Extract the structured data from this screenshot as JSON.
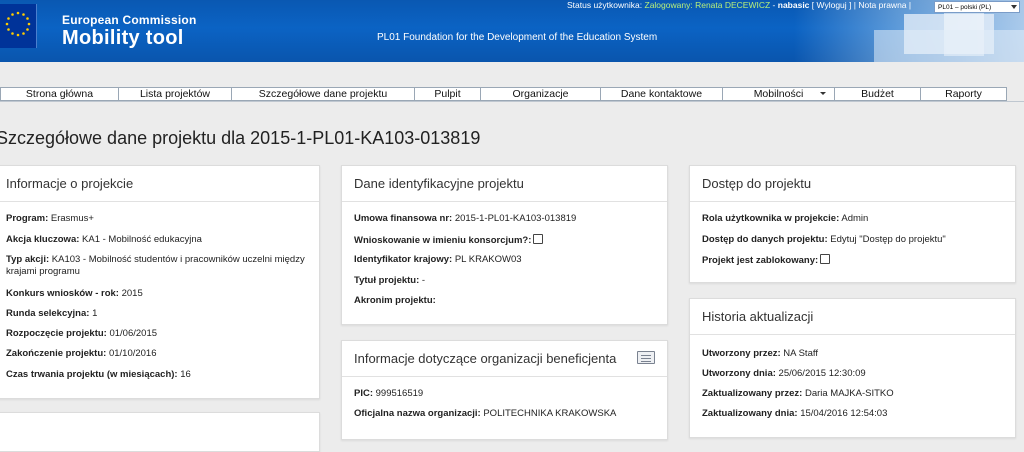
{
  "header": {
    "brand_line1": "European Commission",
    "brand_line2": "Mobility tool",
    "organisation": "PL01 Foundation for the Development of the Education System",
    "status_label": "Status użytkownika:",
    "logged_in_label": "Zalogowany:",
    "user_name": "Renata DECEWICZ",
    "user_login": "nabasic",
    "logout_label": "Wyloguj",
    "legal_label": "Nota prawna",
    "language_value": "PL01 – polski (PL)"
  },
  "nav": {
    "items": [
      {
        "label": "Strona główna"
      },
      {
        "label": "Lista projektów"
      },
      {
        "label": "Szczegółowe dane projektu"
      },
      {
        "label": "Pulpit"
      },
      {
        "label": "Organizacje"
      },
      {
        "label": "Dane kontaktowe"
      },
      {
        "label": "Mobilności"
      },
      {
        "label": "Budżet"
      },
      {
        "label": "Raporty"
      }
    ]
  },
  "page": {
    "title": "Szczegółowe dane projektu dla 2015-1-PL01-KA103-013819"
  },
  "project_info": {
    "title": "Informacje o projekcie",
    "rows": [
      {
        "label": "Program:",
        "value": "Erasmus+"
      },
      {
        "label": "Akcja kluczowa:",
        "value": "KA1 - Mobilność edukacyjna"
      },
      {
        "label": "Typ akcji:",
        "value": "KA103 - Mobilność studentów i pracowników uczelni między"
      },
      {
        "label": "",
        "value": "krajami programu"
      },
      {
        "label": "Konkurs wniosków - rok:",
        "value": "2015"
      },
      {
        "label": "Runda selekcyjna:",
        "value": "1"
      },
      {
        "label": "Rozpoczęcie projektu:",
        "value": "01/06/2015"
      },
      {
        "label": "Zakończenie projektu:",
        "value": "01/10/2016"
      },
      {
        "label": "Czas trwania projektu (w miesiącach):",
        "value": "16"
      }
    ]
  },
  "identification": {
    "title": "Dane identyfikacyjne projektu",
    "rows": [
      {
        "label": "Umowa finansowa nr:",
        "value": "2015-1-PL01-KA103-013819"
      },
      {
        "label": "Wnioskowanie w imieniu konsorcjum?:",
        "value": ""
      },
      {
        "label": "Identyfikator krajowy:",
        "value": "PL KRAKOW03"
      },
      {
        "label": "Tytuł projektu:",
        "value": "-"
      },
      {
        "label": "Akronim projektu:",
        "value": ""
      }
    ]
  },
  "beneficiary": {
    "title": "Informacje dotyczące organizacji beneficjenta",
    "icon": "business-card-icon",
    "rows": [
      {
        "label": "PIC:",
        "value": "999516519"
      },
      {
        "label": "Oficjalna nazwa organizacji:",
        "value": "POLITECHNIKA KRAKOWSKA"
      }
    ]
  },
  "access": {
    "title": "Dostęp do projektu",
    "rows": [
      {
        "label": "Rola użytkownika w projekcie:",
        "value": "Admin"
      },
      {
        "label": "Dostęp do danych projektu:",
        "value": "Edytuj \"Dostęp do projektu\""
      },
      {
        "label": "Projekt jest zablokowany:",
        "value": ""
      }
    ]
  },
  "history": {
    "title": "Historia aktualizacji",
    "rows": [
      {
        "label": "Utworzony przez:",
        "value": "NA Staff"
      },
      {
        "label": "Utworzony dnia:",
        "value": "25/06/2015 12:30:09"
      },
      {
        "label": "Zaktualizowany przez:",
        "value": "Daria MAJKA-SITKO"
      },
      {
        "label": "Zaktualizowany dnia:",
        "value": "15/04/2016 12:54:03"
      }
    ]
  },
  "colors": {
    "header_blue": "#0b63c4",
    "status_green": "#b7ef7a",
    "page_background": "#ececec"
  }
}
